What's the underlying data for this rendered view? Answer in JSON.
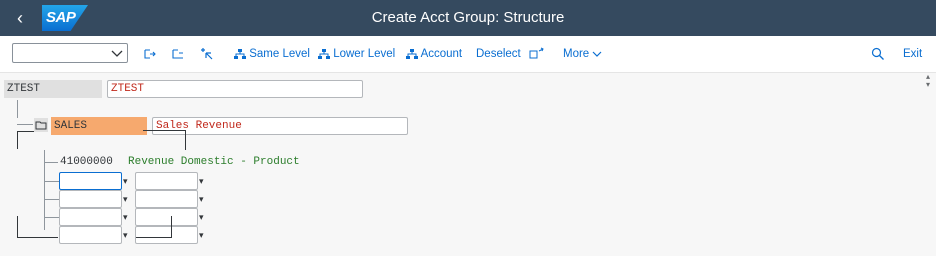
{
  "shell": {
    "title": "Create Acct Group: Structure",
    "logo": "SAP"
  },
  "toolbar": {
    "same_level": "Same Level",
    "lower_level": "Lower Level",
    "account": "Account",
    "deselect": "Deselect",
    "more": "More",
    "exit": "Exit"
  },
  "tree": {
    "root": {
      "code": "ZTEST",
      "description": "ZTEST"
    },
    "group": {
      "code": "SALES",
      "description": "Sales Revenue"
    },
    "account": {
      "number": "41000000",
      "description": "Revenue Domestic - Product"
    }
  }
}
